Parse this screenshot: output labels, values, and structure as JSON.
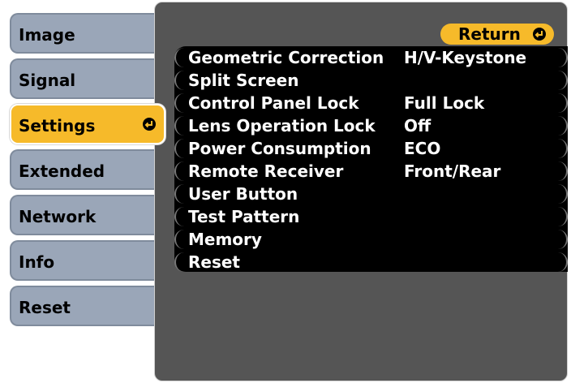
{
  "tabs": [
    {
      "label": "Image"
    },
    {
      "label": "Signal"
    },
    {
      "label": "Settings"
    },
    {
      "label": "Extended"
    },
    {
      "label": "Network"
    },
    {
      "label": "Info"
    },
    {
      "label": "Reset"
    }
  ],
  "selected_tab": "Settings",
  "return_button": {
    "label": "Return"
  },
  "settings": [
    {
      "label": "Geometric Correction",
      "value": "H/V-Keystone"
    },
    {
      "label": "Split Screen",
      "value": ""
    },
    {
      "label": "Control Panel Lock",
      "value": "Full Lock"
    },
    {
      "label": "Lens Operation Lock",
      "value": "Off"
    },
    {
      "label": "Power Consumption",
      "value": "ECO"
    },
    {
      "label": "Remote Receiver",
      "value": "Front/Rear"
    },
    {
      "label": "User Button",
      "value": ""
    },
    {
      "label": "Test Pattern",
      "value": ""
    },
    {
      "label": "Memory",
      "value": ""
    },
    {
      "label": "Reset",
      "value": ""
    }
  ],
  "colors": {
    "tab_bg": "#9aa6b8",
    "selected_accent": "#f6ba2a",
    "panel_bg": "#555555",
    "list_bg": "#000000",
    "text_on_list": "#ffffff"
  },
  "icons": {
    "enter": "enter-icon"
  }
}
